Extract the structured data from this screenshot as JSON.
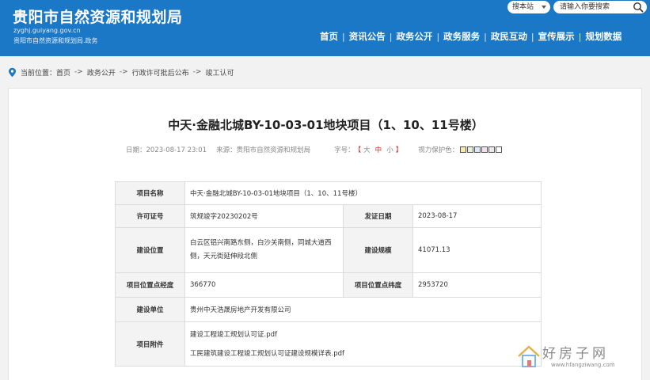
{
  "header": {
    "title": "贵阳市自然资源和规划局",
    "url": "zyghj.guiyang.gov.cn",
    "subtitle": "贵阳市自然资源和规划局.政务",
    "search_scope": "搜本站",
    "search_placeholder": "请输入你要搜索",
    "nav": [
      "首页",
      "资讯公告",
      "政务公开",
      "政务服务",
      "政民互动",
      "宣传展示",
      "规划数据"
    ],
    "nav_sep": "|"
  },
  "breadcrumb": {
    "prefix": "当前位置：",
    "items": [
      "首页",
      "政务公开",
      "行政许可批后公布",
      "竣工认可"
    ],
    "sep": "->"
  },
  "article": {
    "title": "中天·金融北城BY-10-03-01地块项目（1、10、11号楼）",
    "date": "日期：2023-08-17 23:01",
    "source": "来源：贵阳市自然资源和规划局",
    "font_label": "字号：",
    "font_open": "【",
    "font_sizes": [
      "大",
      "中",
      "小"
    ],
    "font_close": "】",
    "vision_label": "视力保护色：",
    "vision_colors": [
      "#fbe9a8",
      "#e8f2d8",
      "#dbe8f6",
      "#f1dff0",
      "#eaeaea",
      "#ffffff"
    ]
  },
  "table": {
    "project_name_label": "项目名称",
    "project_name": "中天·金融北城BY-10-03-01地块项目（1、10、11号楼）",
    "permit_no_label": "许可证号",
    "permit_no": "筑规竣字20230202号",
    "issue_date_label": "发证日期",
    "issue_date": "2023-08-17",
    "location_label": "建设位置",
    "location": "白云区铝兴南路东侧，白沙关南侧，同城大道西侧，天元街延伸段北侧",
    "scale_label": "建设规模",
    "scale": "41071.13",
    "lng_label": "项目位置点经度",
    "lng": "366770",
    "lat_label": "项目位置点纬度",
    "lat": "2953720",
    "unit_label": "建设单位",
    "unit": "贵州中天浩晟房地产开发有限公司",
    "attach_label": "项目附件",
    "attachments": [
      "建设工程竣工规划认可证.pdf",
      "工民建筑建设工程竣工规划认可证建设规模详表.pdf"
    ]
  },
  "watermark": {
    "text": "好房子网",
    "url": "www.hfangziwang.com"
  }
}
